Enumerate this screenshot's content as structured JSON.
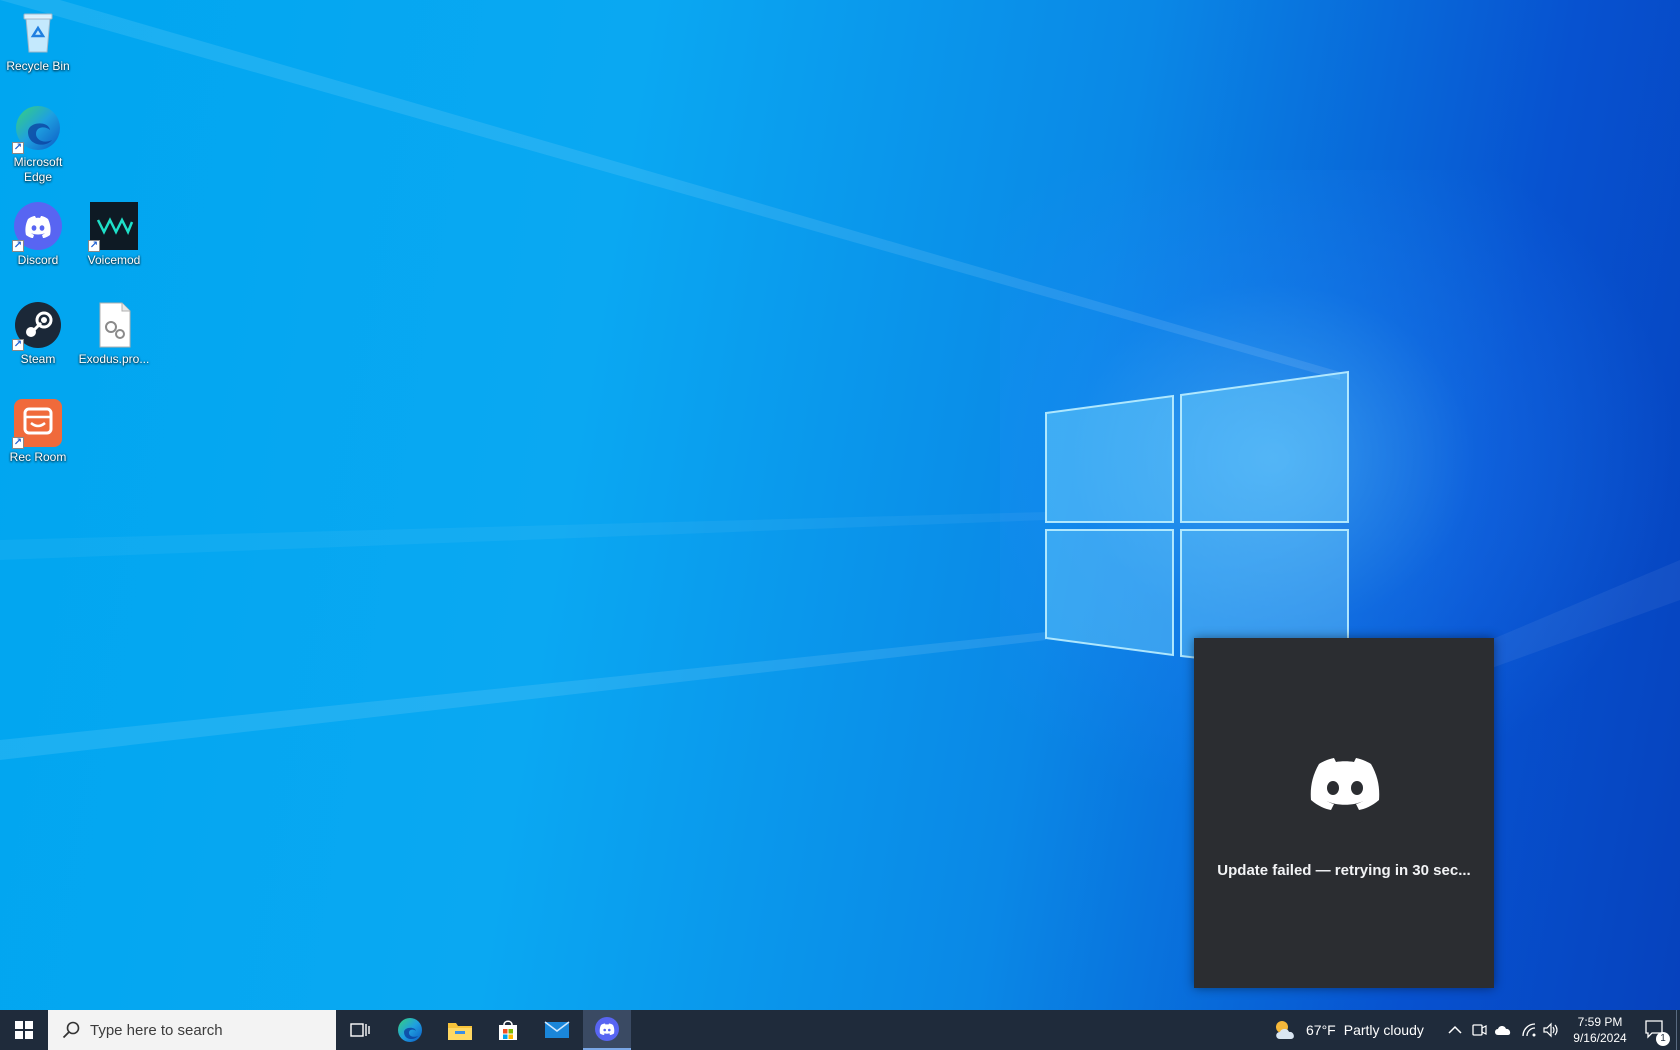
{
  "desktop": {
    "icons": [
      {
        "label": "Recycle Bin"
      },
      {
        "label": "Microsoft\nEdge"
      },
      {
        "label": "Discord"
      },
      {
        "label": "Voicemod"
      },
      {
        "label": "Steam"
      },
      {
        "label": "Exodus.pro..."
      },
      {
        "label": "Rec Room"
      }
    ]
  },
  "toast": {
    "app": "Discord",
    "message": "Update failed — retrying in 30 sec..."
  },
  "taskbar": {
    "search_placeholder": "Type here to search",
    "pinned": [
      "Task View",
      "Microsoft Edge",
      "File Explorer",
      "Microsoft Store",
      "Mail",
      "Discord"
    ],
    "active_app": "Discord",
    "weather": {
      "temp": "67°F",
      "condition": "Partly cloudy"
    },
    "clock": {
      "time": "7:59 PM",
      "date": "9/16/2024"
    },
    "notification_count": "1"
  },
  "colors": {
    "taskbar": "#1f2b3b",
    "toast_bg": "#2b2d31",
    "discord_blurple": "#5865f2",
    "wallpaper_blue": "#0a88e6"
  }
}
